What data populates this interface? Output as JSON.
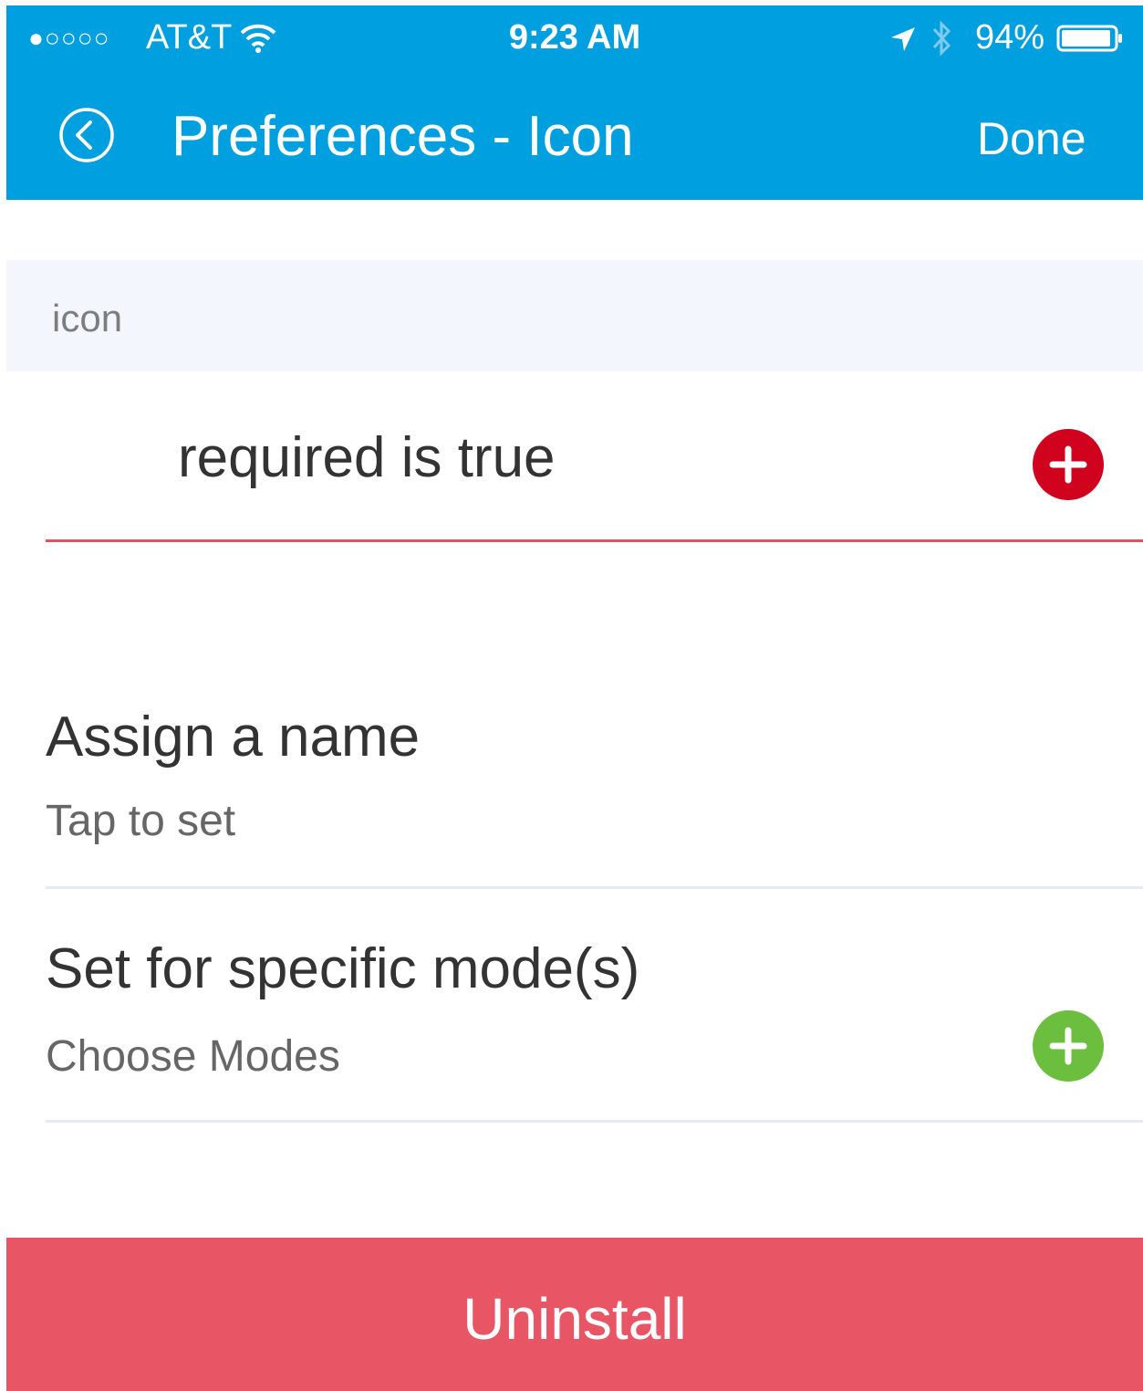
{
  "status_bar": {
    "signal": "●○○○○",
    "carrier": "AT&T",
    "wifi_icon": "wifi-icon",
    "time": "9:23 AM",
    "location_icon": "location-arrow-icon",
    "bluetooth_icon": "bluetooth-icon",
    "battery_percent": "94%",
    "battery_level": 0.94
  },
  "nav": {
    "back_icon": "back-chevron-circle-icon",
    "title": "Preferences - Icon",
    "done_label": "Done"
  },
  "section": {
    "header_label": "icon"
  },
  "rule": {
    "text": "required is true",
    "add_icon": "plus-circle-icon",
    "accent_color": "#d1021d"
  },
  "name_setting": {
    "title": "Assign a name",
    "subtitle": "Tap to set"
  },
  "mode_setting": {
    "title": "Set for specific mode(s)",
    "subtitle": "Choose Modes",
    "add_icon": "plus-circle-icon",
    "accent_color": "#6cbe3f"
  },
  "uninstall": {
    "label": "Uninstall",
    "color": "#e85564"
  },
  "colors": {
    "header": "#009fdf",
    "section_bg": "#f3f7fd"
  }
}
